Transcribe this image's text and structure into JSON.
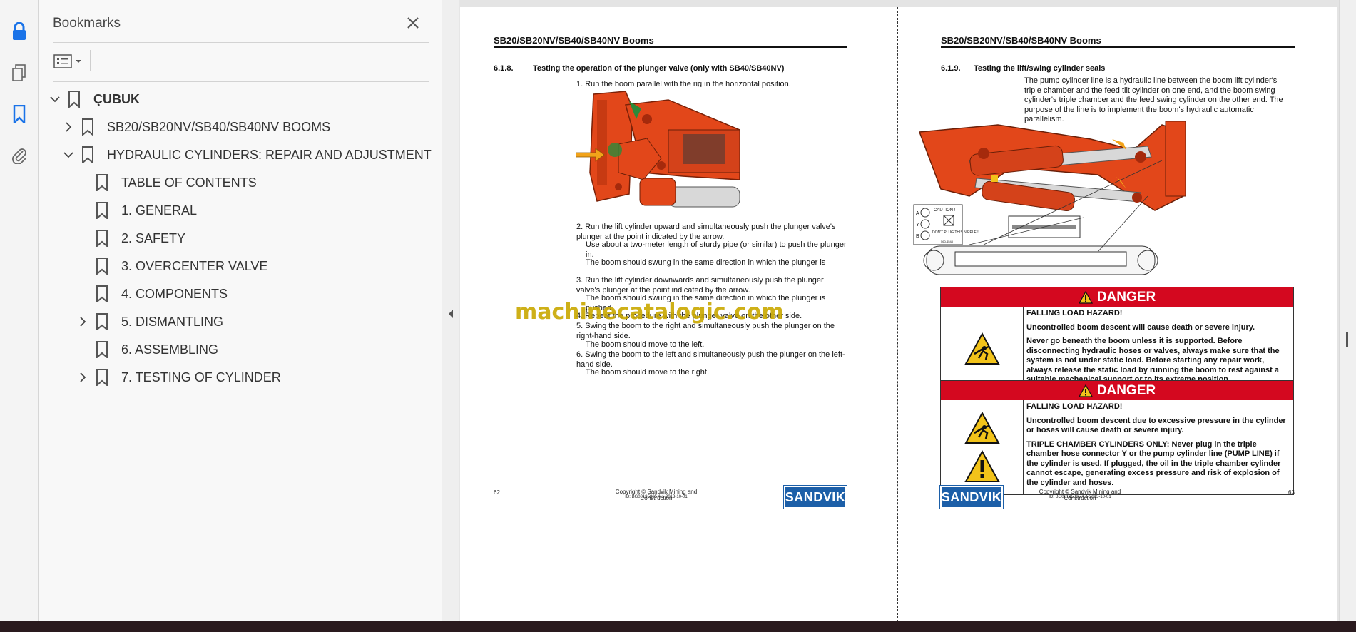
{
  "panel": {
    "title": "Bookmarks",
    "bookmarks": [
      {
        "label": "ÇUBUK"
      },
      {
        "label": "SB20/SB20NV/SB40/SB40NV BOOMS"
      },
      {
        "label": "HYDRAULIC CYLINDERS: REPAIR AND ADJUSTMENT"
      },
      {
        "label": "TABLE OF CONTENTS"
      },
      {
        "label": "1. GENERAL"
      },
      {
        "label": "2. SAFETY"
      },
      {
        "label": "3. OVERCENTER VALVE"
      },
      {
        "label": "4. COMPONENTS"
      },
      {
        "label": "5. DISMANTLING"
      },
      {
        "label": "6. ASSEMBLING"
      },
      {
        "label": "7. TESTING OF CYLINDER"
      }
    ]
  },
  "left_page": {
    "header": "SB20/SB20NV/SB40/SB40NV Booms",
    "section_no": "6.1.8.",
    "section_title": "Testing the operation of the plunger valve (only with SB40/SB40NV)",
    "steps": [
      "1. Run the boom parallel with the rig in the horizontal position.",
      "2. Run the lift cylinder upward and simultaneously push the plunger valve's plunger at the point indicated by the arrow.",
      "Use about a two-meter length of sturdy pipe (or similar) to push the plunger in.",
      "The boom should swung in the same direction in which the plunger is",
      "3. Run the lift cylinder downwards and simultaneously push the plunger valve's plunger at the point indicated by the arrow.",
      "The boom should swung in the same direction in which the plunger is pushed.",
      "4. Repeat the procedure with the plunger valve on the other side.",
      "5. Swing the boom to the right and simultaneously push the plunger on the right-hand side.",
      "The boom should move to the left.",
      "6. Swing the boom to the left and simultaneously push the plunger on the left-hand side.",
      "The boom should move to the right."
    ],
    "page_number": "62",
    "copyright": "Copyright © Sandvik Mining and Construction",
    "doc_id": "ID: BG00195885 A.1 2013-10-01",
    "logo": "SANDVIK"
  },
  "right_page": {
    "header": "SB20/SB20NV/SB40/SB40NV Booms",
    "section_no": "6.1.9.",
    "section_title": "Testing the lift/swing cylinder seals",
    "intro": "The pump cylinder line is a hydraulic line between the boom lift cylinder's triple chamber and the feed tilt cylinder on one end, and the boom swing cylinder's triple chamber and the feed swing cylinder on the other end. The purpose of the line is to implement the boom's hydraulic automatic parallelism.",
    "caution_label": "CAUTION !",
    "caution_text": "DON'T PLUG THIS NIPPLE !",
    "caution_code": "560-4548",
    "caution_letters": [
      "A",
      "Y",
      "B"
    ],
    "danger1": {
      "title": "DANGER",
      "lines": [
        "FALLING LOAD HAZARD!",
        "Uncontrolled boom descent will cause death or severe injury.",
        "Never go beneath the boom unless it is supported. Before disconnecting hydraulic hoses or valves, always make sure that the system is not under static load. Before starting any repair work, always release the static load by running the boom to rest against a suitable mechanical support or to its extreme position."
      ]
    },
    "danger2": {
      "title": "DANGER",
      "lines": [
        "FALLING LOAD HAZARD!",
        "Uncontrolled boom descent due to excessive pressure in the cylinder or hoses will cause death or severe injury.",
        "TRIPLE CHAMBER CYLINDERS ONLY: Never plug in the triple chamber hose connector Y or the pump cylinder line (PUMP LINE) if the cylinder is used. If plugged, the oil in the triple chamber cylinder cannot escape, generating excess pressure and risk of explosion of the cylinder and hoses."
      ]
    },
    "page_number": "63",
    "copyright": "Copyright © Sandvik Mining and Construction",
    "doc_id": "ID: BG00195885 A.1 2013-10-01",
    "logo": "SANDVIK"
  },
  "watermark": "machinecatalogic.com",
  "colors": {
    "accent": "#1a73e8",
    "danger_red": "#d4081f",
    "boom_orange": "#e2471a",
    "sandvik_blue": "#1c5fa8"
  }
}
